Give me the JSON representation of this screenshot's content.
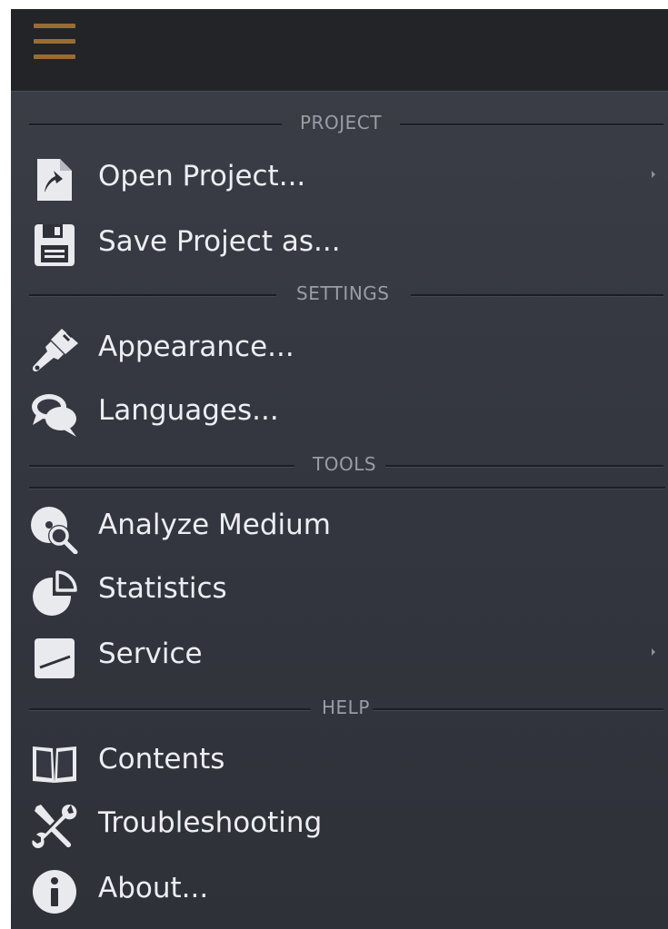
{
  "menu": {
    "sections": {
      "project": "PROJECT",
      "settings": "SETTINGS",
      "tools": "TOOLS",
      "help": "HELP"
    },
    "items": {
      "open_project": "Open Project...",
      "save_project": "Save Project as...",
      "appearance": "Appearance...",
      "languages": "Languages...",
      "analyze_medium": "Analyze Medium",
      "statistics": "Statistics",
      "service": "Service",
      "contents": "Contents",
      "troubleshooting": "Troubleshooting",
      "about": "About..."
    }
  },
  "colors": {
    "accent": "#9a6c34",
    "menu_bg": "#363943",
    "text": "#eceef2",
    "section_text": "#9a9da5"
  },
  "icons": {
    "menu": "hamburger-icon",
    "open_project": "open-file-icon",
    "save_project": "floppy-disk-icon",
    "appearance": "paintbrush-icon",
    "languages": "speech-bubbles-icon",
    "analyze_medium": "disc-magnifier-icon",
    "statistics": "pie-chart-icon",
    "service": "service-icon",
    "contents": "open-book-icon",
    "troubleshooting": "tools-icon",
    "about": "info-icon"
  }
}
